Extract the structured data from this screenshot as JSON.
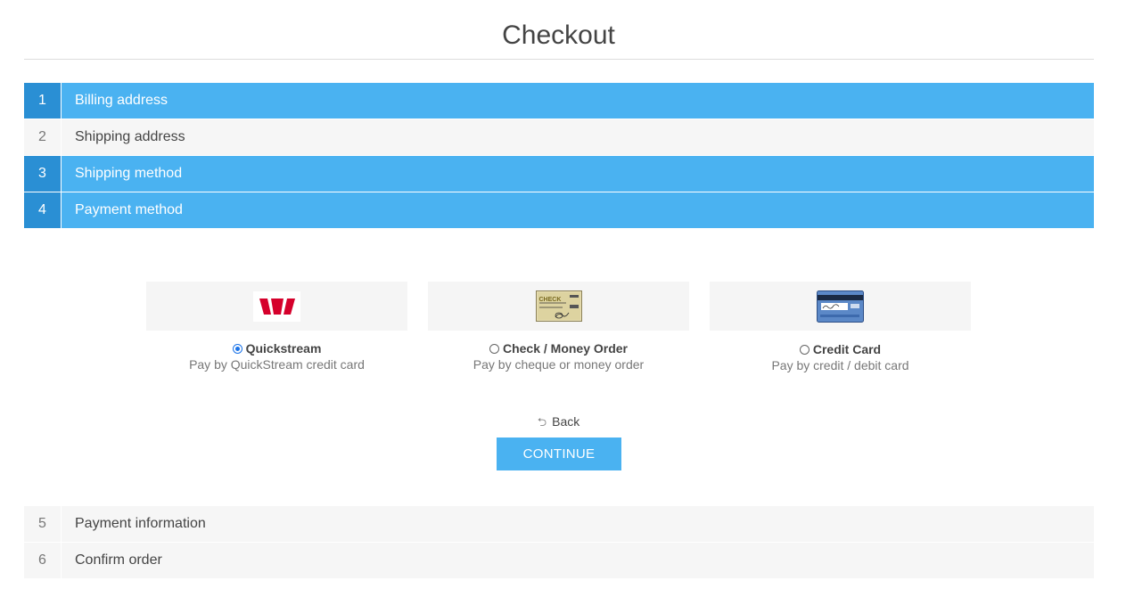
{
  "page": {
    "title": "Checkout"
  },
  "steps_top": [
    {
      "number": "1",
      "label": "Billing address",
      "state": "active"
    },
    {
      "number": "2",
      "label": "Shipping address",
      "state": "inactive"
    },
    {
      "number": "3",
      "label": "Shipping method",
      "state": "active"
    },
    {
      "number": "4",
      "label": "Payment method",
      "state": "active"
    }
  ],
  "payment_methods": [
    {
      "name": "Quickstream",
      "description": "Pay by QuickStream credit card",
      "selected": true,
      "icon": "westpac-logo-icon"
    },
    {
      "name": "Check / Money Order",
      "description": "Pay by cheque or money order",
      "selected": false,
      "icon": "check-icon"
    },
    {
      "name": "Credit Card",
      "description": "Pay by credit / debit card",
      "selected": false,
      "icon": "credit-card-icon"
    }
  ],
  "check_logo_text": "CHECK",
  "actions": {
    "back_label": "Back",
    "continue_label": "CONTINUE"
  },
  "steps_bottom": [
    {
      "number": "5",
      "label": "Payment information",
      "state": "inactive"
    },
    {
      "number": "6",
      "label": "Confirm order",
      "state": "inactive"
    }
  ],
  "colors": {
    "active": "#4ab2f1",
    "active_number": "#2a8fd4",
    "inactive": "#f6f6f6",
    "westpac_red": "#d5002b"
  }
}
